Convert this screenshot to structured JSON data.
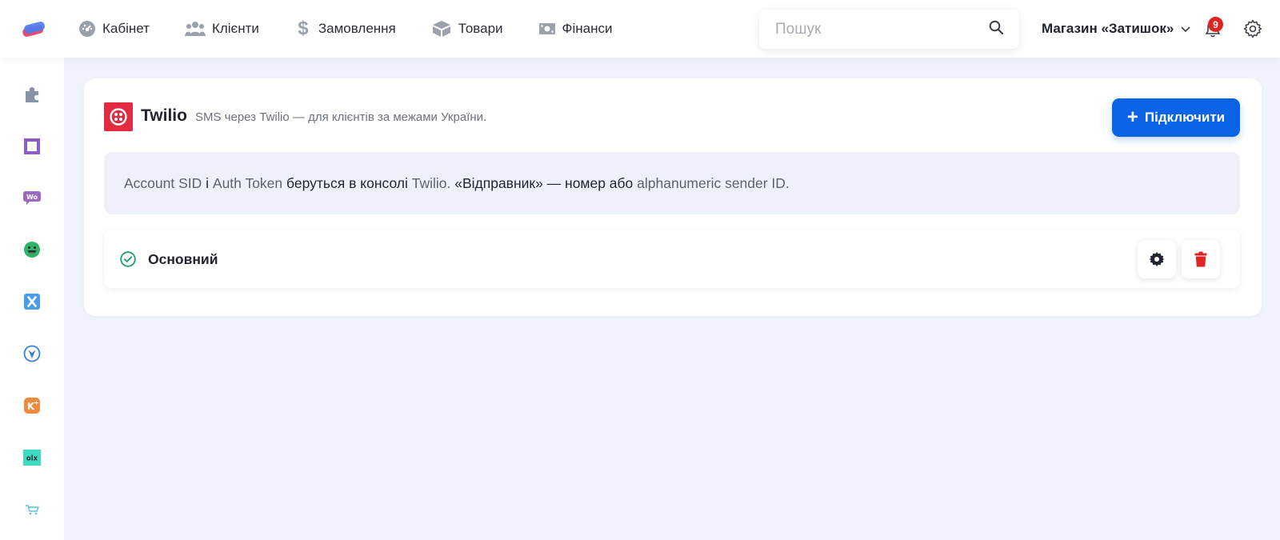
{
  "topbar": {
    "nav": [
      {
        "label": "Кабінет",
        "icon": "dashboard-icon"
      },
      {
        "label": "Клієнти",
        "icon": "users-icon"
      },
      {
        "label": "Замовлення",
        "icon": "dollar-icon"
      },
      {
        "label": "Товари",
        "icon": "box-icon"
      },
      {
        "label": "Фінанси",
        "icon": "money-icon"
      }
    ],
    "search_placeholder": "Пошук",
    "store_name": "Магазин «Затишок»",
    "notifications_count": "9"
  },
  "sidebar": {
    "items": [
      {
        "icon": "puzzle-icon",
        "color": "#8a93a6"
      },
      {
        "icon": "square-app-icon",
        "color": "#8e5cc4"
      },
      {
        "icon": "woo-icon",
        "color": "#9b6bc0"
      },
      {
        "icon": "smiley-app-icon",
        "color": "#2fb36b"
      },
      {
        "icon": "x-app-icon",
        "color": "#4a9be8"
      },
      {
        "icon": "vchasno-icon",
        "color": "#3b7fd4"
      },
      {
        "icon": "k-plus-icon",
        "color": "#f08a3e"
      },
      {
        "icon": "olx-icon",
        "color": "#3fdac4"
      },
      {
        "icon": "cart-app-icon",
        "color": "#5ec2e0"
      }
    ]
  },
  "integration": {
    "title": "Twilio",
    "description": "SMS через Twilio — для клієнтів за межами України.",
    "connect_label": "Підключити",
    "brand_color": "#e22b40",
    "info": {
      "p1": "Account SID",
      "p2": " і ",
      "p3": "Auth Token",
      "p4": " беруться в консолі ",
      "p5": "Twilio.",
      "p6": " «Відправник» — номер або ",
      "p7": "alphanumeric sender ID."
    },
    "accounts": [
      {
        "name": "Основний",
        "status": "active"
      }
    ]
  },
  "colors": {
    "accent": "#0b63e5",
    "danger": "#e02424",
    "success": "#1f9d6a"
  }
}
